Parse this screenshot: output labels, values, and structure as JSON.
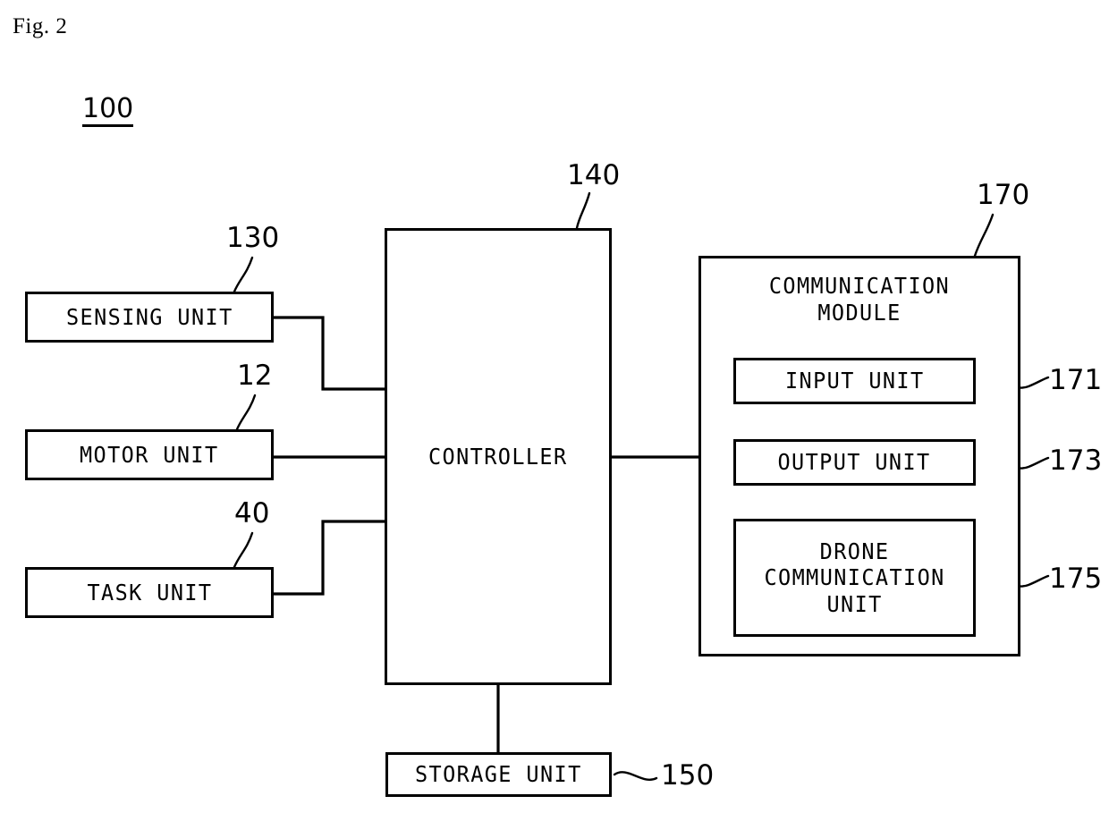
{
  "figure": {
    "caption": "Fig. 2",
    "system_ref": "100"
  },
  "blocks": {
    "sensing_unit": {
      "label": "SENSING UNIT",
      "ref": "130"
    },
    "motor_unit": {
      "label": "MOTOR UNIT",
      "ref": "12"
    },
    "task_unit": {
      "label": "TASK UNIT",
      "ref": "40"
    },
    "controller": {
      "label": "CONTROLLER",
      "ref": "140"
    },
    "storage_unit": {
      "label": "STORAGE UNIT",
      "ref": "150"
    },
    "communication_module": {
      "label": "COMMUNICATION\nMODULE",
      "ref": "170",
      "children": {
        "input_unit": {
          "label": "INPUT UNIT",
          "ref": "171"
        },
        "output_unit": {
          "label": "OUTPUT UNIT",
          "ref": "173"
        },
        "drone_communication_unit": {
          "label": "DRONE\nCOMMUNICATION\nUNIT",
          "ref": "175"
        }
      }
    }
  },
  "colors": {
    "ink": "#000000",
    "background": "#ffffff"
  }
}
